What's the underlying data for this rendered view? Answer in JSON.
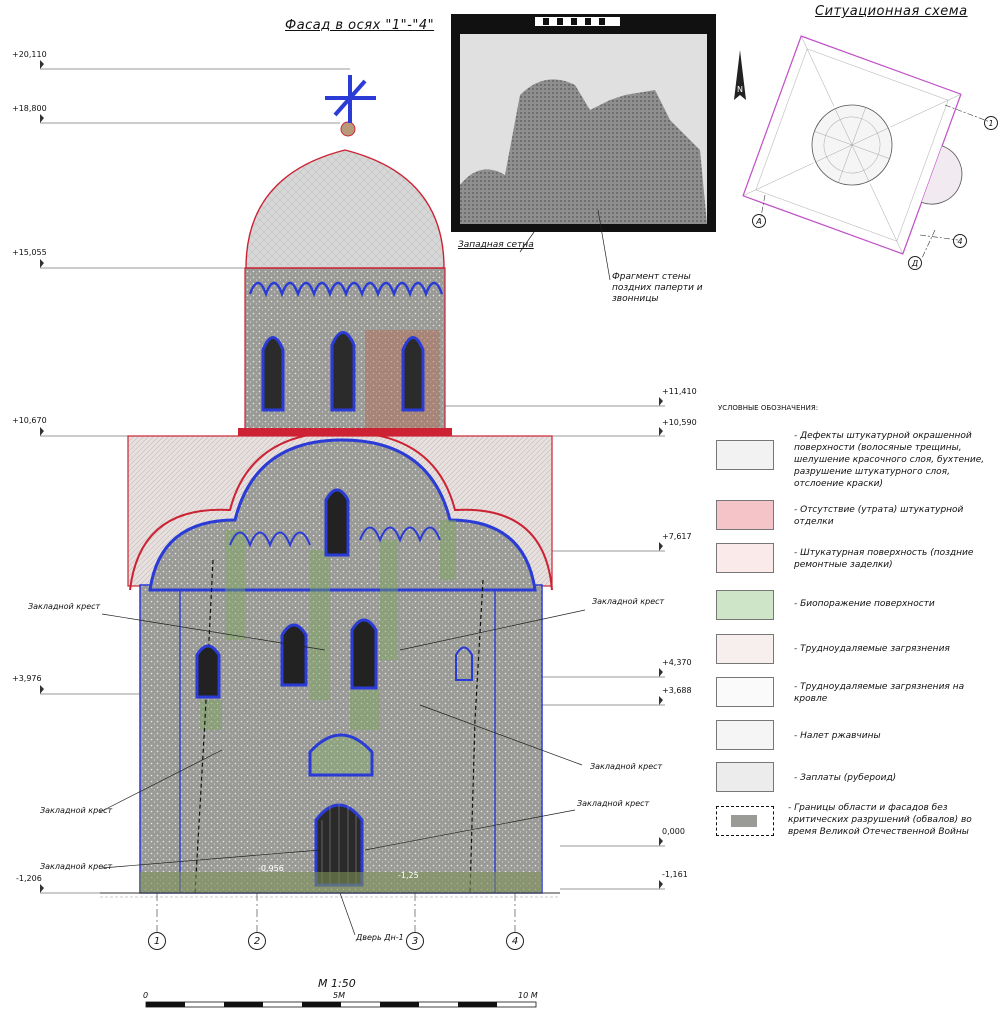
{
  "facade_title": "Фасад в осях \"1\"-\"4\"",
  "situation_title": "Ситуационная схема",
  "photo_labels": {
    "west_wall": "Западная сетна",
    "fragment": "Фрагмент стены поздних паперти и звонницы"
  },
  "elevations_left": [
    "+20,110",
    "+18,800",
    "+15,055",
    "+10,670",
    "+3,976",
    "-1,206"
  ],
  "elevations_right": [
    "+11,410",
    "+10,590",
    "+7,617",
    "+4,370",
    "+3,688",
    "0,000",
    "-1,161"
  ],
  "inner_marks": [
    "-0,956",
    "-1,25"
  ],
  "callouts": {
    "cross1": "Закладной крест",
    "cross2": "Закладной крест",
    "cross3": "Закладной крест",
    "cross4": "Закладной крест",
    "cross5": "Закладной крест",
    "cross6": "Закладной крест",
    "door": "Дверь Дн-1"
  },
  "axes": [
    "1",
    "2",
    "3",
    "4"
  ],
  "plan_axes": [
    "А",
    "Д",
    "1",
    "4"
  ],
  "scale": {
    "title": "М 1:50",
    "zero": "0",
    "mid": "5М",
    "end": "10 М"
  },
  "legend_title": "УСЛОВНЫЕ ОБОЗНАЧЕНИЯ:",
  "legend": [
    {
      "text": "- Дефекты штукатурной окрашенной поверхности (волосяные трещины, шелушение красочного слоя, бухтение, разрушение штукатурного слоя, отслоение краски)",
      "color": "#f2f2f2"
    },
    {
      "text": "- Отсутствие (утрата) штукатурной отделки",
      "color": "#f4c4c8"
    },
    {
      "text": "- Штукатурная поверхность (поздние ремонтные заделки)",
      "color": "#fbeaea"
    },
    {
      "text": "- Биопоражение поверхности",
      "color": "#cfe5c8"
    },
    {
      "text": "- Трудноудаляемые загрязнения",
      "color": "#f7eeee"
    },
    {
      "text": "- Трудноудаляемые загрязнения на кровле",
      "color": "#fafafa"
    },
    {
      "text": "- Налет ржавчины",
      "color": "#f5f5f5"
    },
    {
      "text": "- Заплаты (рубероид)",
      "color": "#ececec"
    },
    {
      "text": "- Границы области и фасадов без критических разрушений (обвалов) во время Великой Отечественной Войны",
      "color": "#ffffff"
    }
  ]
}
